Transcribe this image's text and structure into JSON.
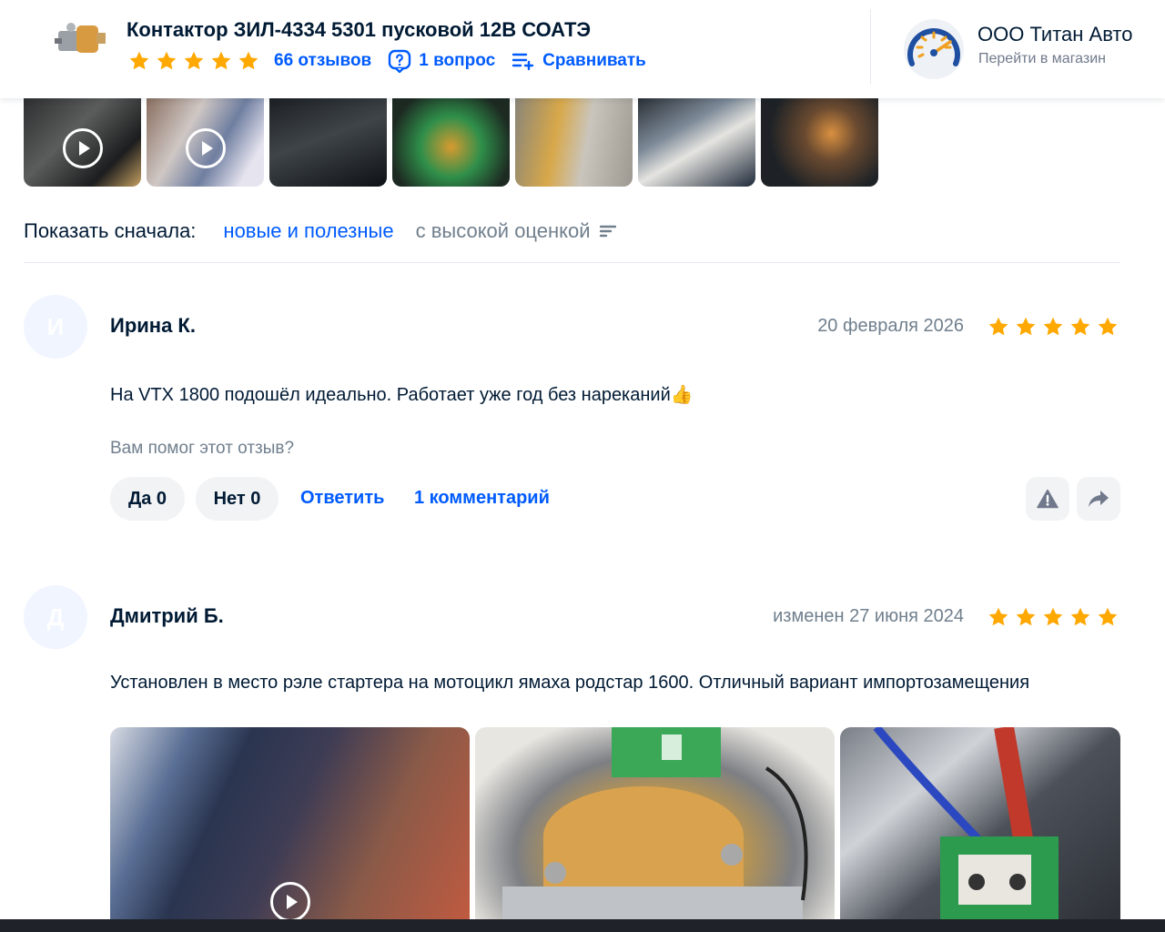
{
  "header": {
    "product_title": "Контактор ЗИЛ-4334 5301 пусковой 12В СОАТЭ",
    "rating_stars": 5,
    "reviews_link": "66 отзывов",
    "question_link": "1 вопрос",
    "compare_link": "Сравнивать",
    "shop_name": "ООО Титан Авто",
    "shop_go": "Перейти в магазин"
  },
  "media_strip": {
    "items": [
      {
        "kind": "video"
      },
      {
        "kind": "video"
      },
      {
        "kind": "photo"
      },
      {
        "kind": "photo"
      },
      {
        "kind": "photo"
      },
      {
        "kind": "photo"
      },
      {
        "kind": "photo"
      }
    ]
  },
  "sort": {
    "label": "Показать сначала:",
    "option_active": "новые и полезные",
    "option_other": "с высокой оценкой"
  },
  "reviews": [
    {
      "initial": "И",
      "author": "Ирина К.",
      "date": "20 февраля 2026",
      "rating": 5,
      "text": "На VTX 1800 подошёл идеально. Работает уже год без нареканий👍",
      "helpful_question": "Вам помог этот отзыв?",
      "yes_label": "Да 0",
      "no_label": "Нет 0",
      "reply_label": "Ответить",
      "comments_label": "1 комментарий"
    },
    {
      "initial": "Д",
      "author": "Дмитрий Б.",
      "date": "изменен 27 июня 2024",
      "rating": 5,
      "text": "Установлен в место рэле стартера на мотоцикл ямаха родстар 1600. Отличный вариант импортозамещения"
    }
  ],
  "colors": {
    "accent": "#005bff",
    "star": "#ffa800",
    "text": "#001a34",
    "muted": "#707f8d",
    "button_bg": "#f2f3f5"
  }
}
